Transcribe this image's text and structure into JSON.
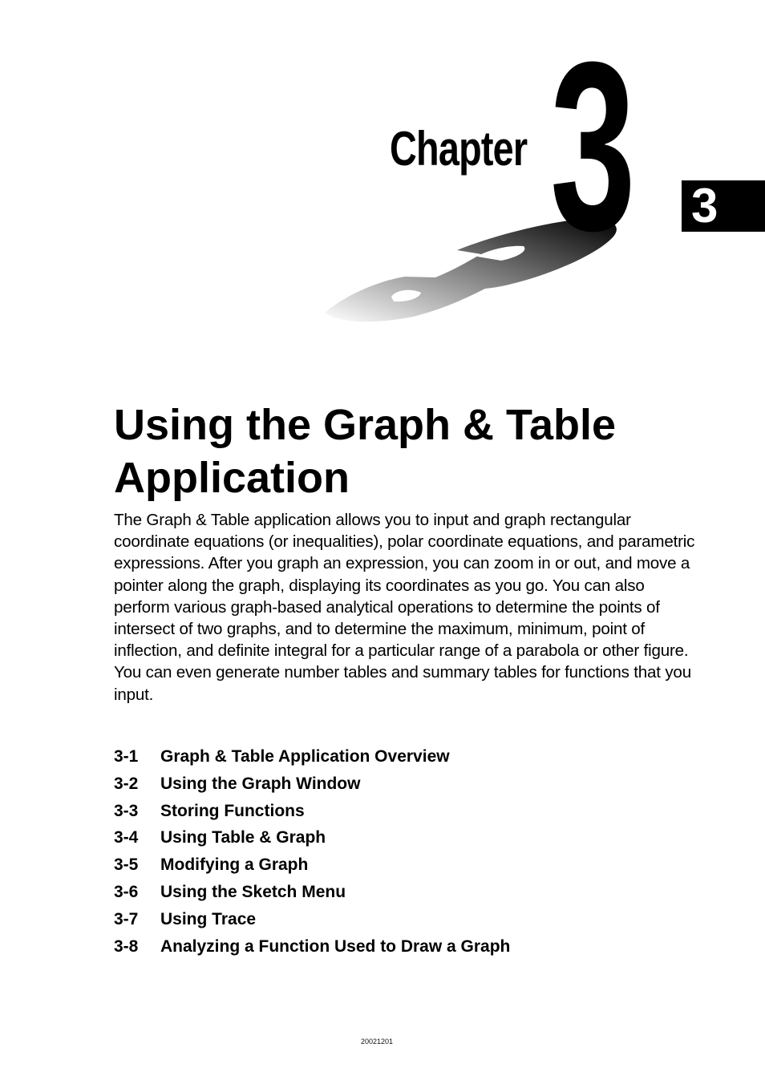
{
  "header": {
    "chapter_word": "Chapter",
    "chapter_number": "3",
    "side_tab_number": "3"
  },
  "graphics": {
    "shadow_gradient": {
      "from": "#ffffff",
      "to": "#000000"
    }
  },
  "title": "Using the Graph & Table Application",
  "intro": "The Graph & Table application allows you to input and graph rectangular coordinate equations (or inequalities), polar coordinate equations, and parametric expressions. After you graph an expression, you can zoom in or out, and move a pointer along the graph, displaying its coordinates as you go. You can also perform various graph-based analytical operations to determine the points of intersect of two graphs, and to determine the maximum, minimum, point of inflection, and definite integral for a particular range of a parabola or other figure. You can even generate number tables and summary tables for functions that you input.",
  "toc": [
    {
      "number": "3-1",
      "label": "Graph & Table Application Overview"
    },
    {
      "number": "3-2",
      "label": "Using the Graph Window"
    },
    {
      "number": "3-3",
      "label": "Storing Functions"
    },
    {
      "number": "3-4",
      "label": "Using Table & Graph"
    },
    {
      "number": "3-5",
      "label": "Modifying a Graph"
    },
    {
      "number": "3-6",
      "label": "Using the Sketch Menu"
    },
    {
      "number": "3-7",
      "label": "Using Trace"
    },
    {
      "number": "3-8",
      "label": "Analyzing a Function Used to Draw a Graph"
    }
  ],
  "footer": {
    "code": "20021201"
  }
}
